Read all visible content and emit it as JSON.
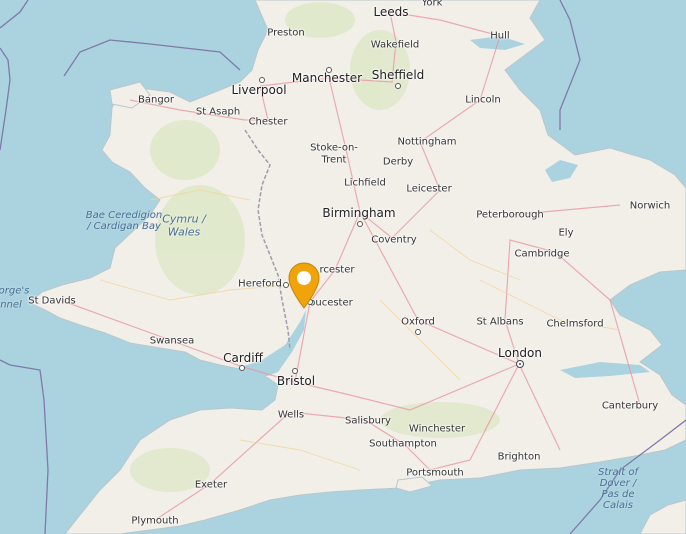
{
  "colors": {
    "sea": "#aad3df",
    "land": "#f2efe9",
    "marker": "#f0a30a",
    "border": "#9e9cab"
  },
  "places": {
    "leeds": "Leeds",
    "york": "York",
    "preston": "Preston",
    "wakefield": "Wakefield",
    "hull": "Hull",
    "manchester": "Manchester",
    "liverpool": "Liverpool",
    "sheffield": "Sheffield",
    "bangor": "Bangor",
    "st_asaph": "St Asaph",
    "lincoln": "Lincoln",
    "chester": "Chester",
    "nottingham": "Nottingham",
    "stoke_on": "Stoke-on-",
    "stoke_trent": "Trent",
    "derby": "Derby",
    "lichfield": "Lichfield",
    "leicester": "Leicester",
    "norwich": "Norwich",
    "birmingham": "Birmingham",
    "peterborough": "Peterborough",
    "coventry": "Coventry",
    "ely": "Ely",
    "cambridge": "Cambridge",
    "worcester": "rcester",
    "hereford": "Hereford",
    "gloucester": "oucester",
    "st_davids": "St Davids",
    "oxford": "Oxford",
    "st_albans": "St Albans",
    "chelmsford": "Chelmsford",
    "swansea": "Swansea",
    "london": "London",
    "cardiff": "Cardiff",
    "bristol": "Bristol",
    "canterbury": "Canterbury",
    "wells": "Wells",
    "salisbury": "Salisbury",
    "winchester": "Winchester",
    "southampton": "Southampton",
    "brighton": "Brighton",
    "portsmouth": "Portsmouth",
    "exeter": "Exeter",
    "plymouth": "Plymouth"
  },
  "regions": {
    "wales_line1": "Cymru /",
    "wales_line2": "Wales",
    "cardigan_bay": "Bae Ceredigion / Cardigan Bay",
    "st_georges_line1": "orge's",
    "st_georges_line2": "nnel",
    "dover": "Strait of Dover / Pas de Calais"
  },
  "marker": {
    "icon": "map-pin-icon"
  }
}
